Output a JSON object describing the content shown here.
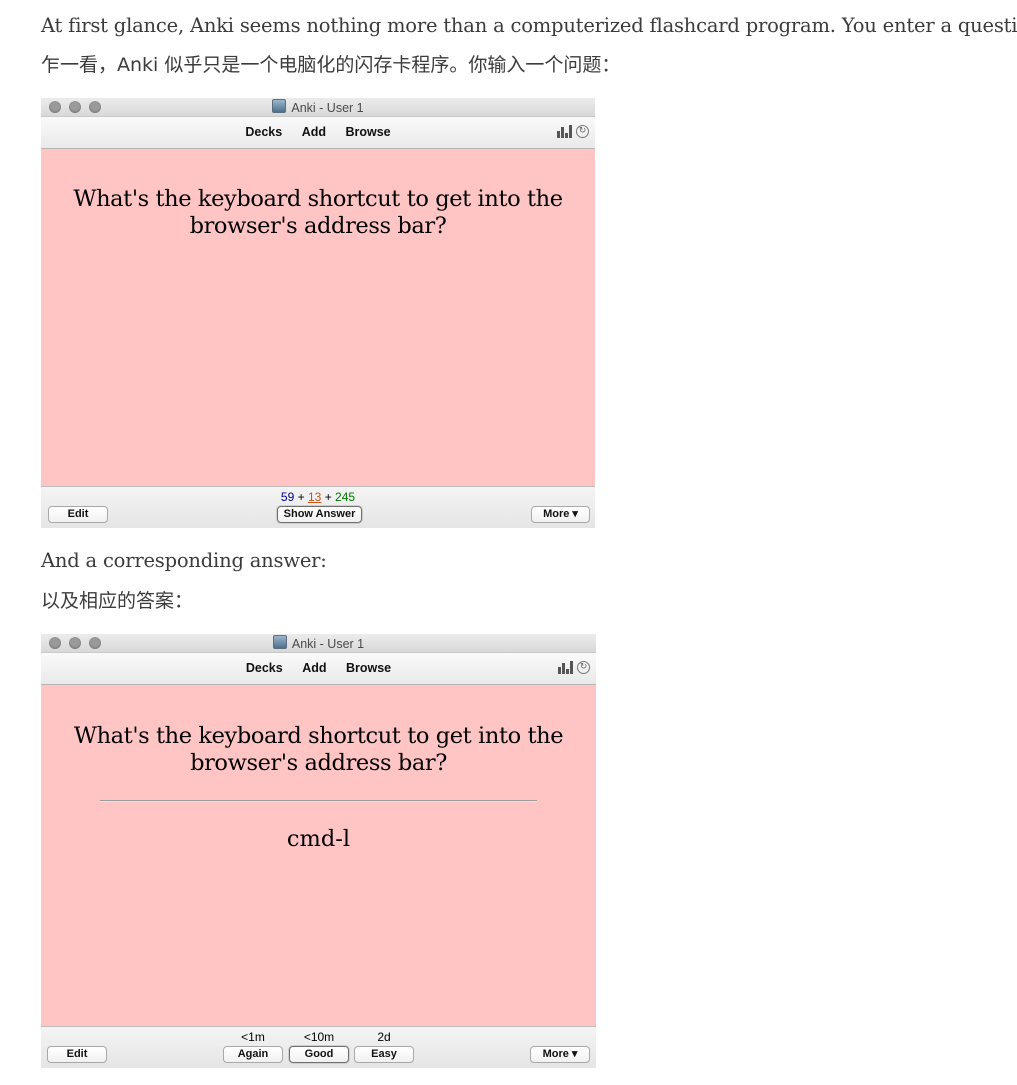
{
  "intro": {
    "en": "At first glance, Anki seems nothing more than a computerized flashcard program. You enter a question:",
    "zh": "乍一看，Anki 似乎只是一个电脑化的闪存卡程序。你输入一个问题："
  },
  "answer_intro": {
    "en": "And a corresponding answer:",
    "zh": "以及相应的答案："
  },
  "window": {
    "title": "Anki - User 1",
    "menu": [
      "Decks",
      "Add",
      "Browse"
    ]
  },
  "card": {
    "question_line1": "What's the keyboard shortcut to get into the",
    "question_line2": "browser's address bar?",
    "answer": "cmd-l"
  },
  "review_bar": {
    "edit": "Edit",
    "show_answer": "Show Answer",
    "more": "More ▾",
    "count_new": "59",
    "count_learning": "13",
    "count_review": "245",
    "plus": "+"
  },
  "answer_bar": {
    "edit": "Edit",
    "more": "More ▾",
    "ease": [
      {
        "time": "<1m",
        "label": "Again"
      },
      {
        "time": "<10m",
        "label": "Good"
      },
      {
        "time": "2d",
        "label": "Easy"
      }
    ]
  }
}
